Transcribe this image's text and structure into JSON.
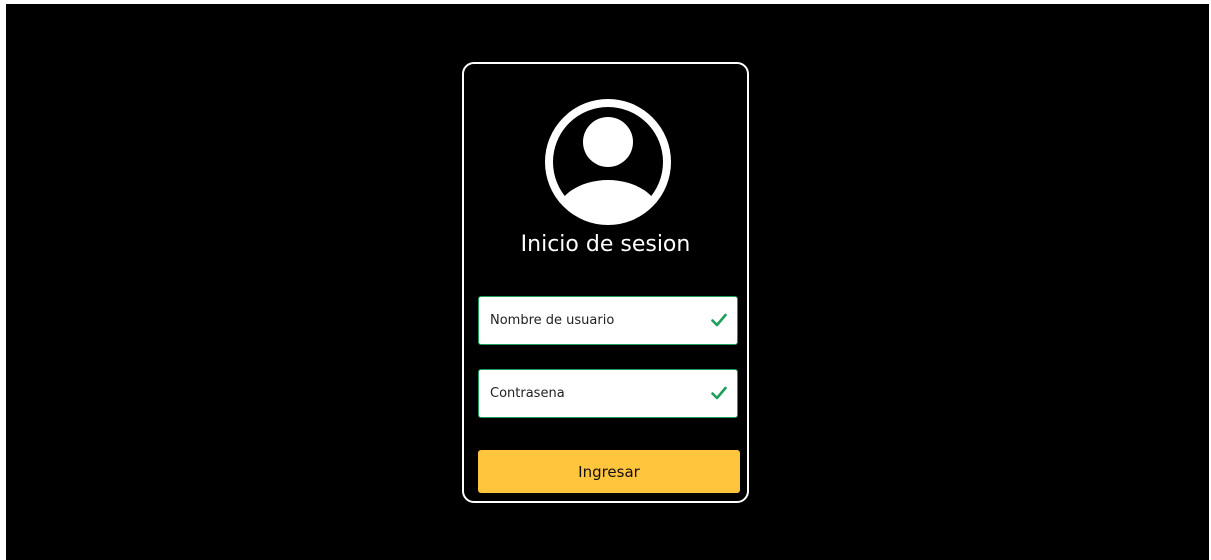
{
  "login": {
    "title": "Inicio de sesion",
    "username_placeholder": "Nombre de usuario",
    "password_placeholder": "Contrasena",
    "submit_label": "Ingresar"
  },
  "icons": {
    "avatar": "user-avatar-icon",
    "valid": "checkmark-icon"
  },
  "colors": {
    "background": "#000000",
    "card_border": "#ffffff",
    "field_border": "#1f9e5c",
    "check": "#1f9e5c",
    "button": "#ffc53d"
  }
}
